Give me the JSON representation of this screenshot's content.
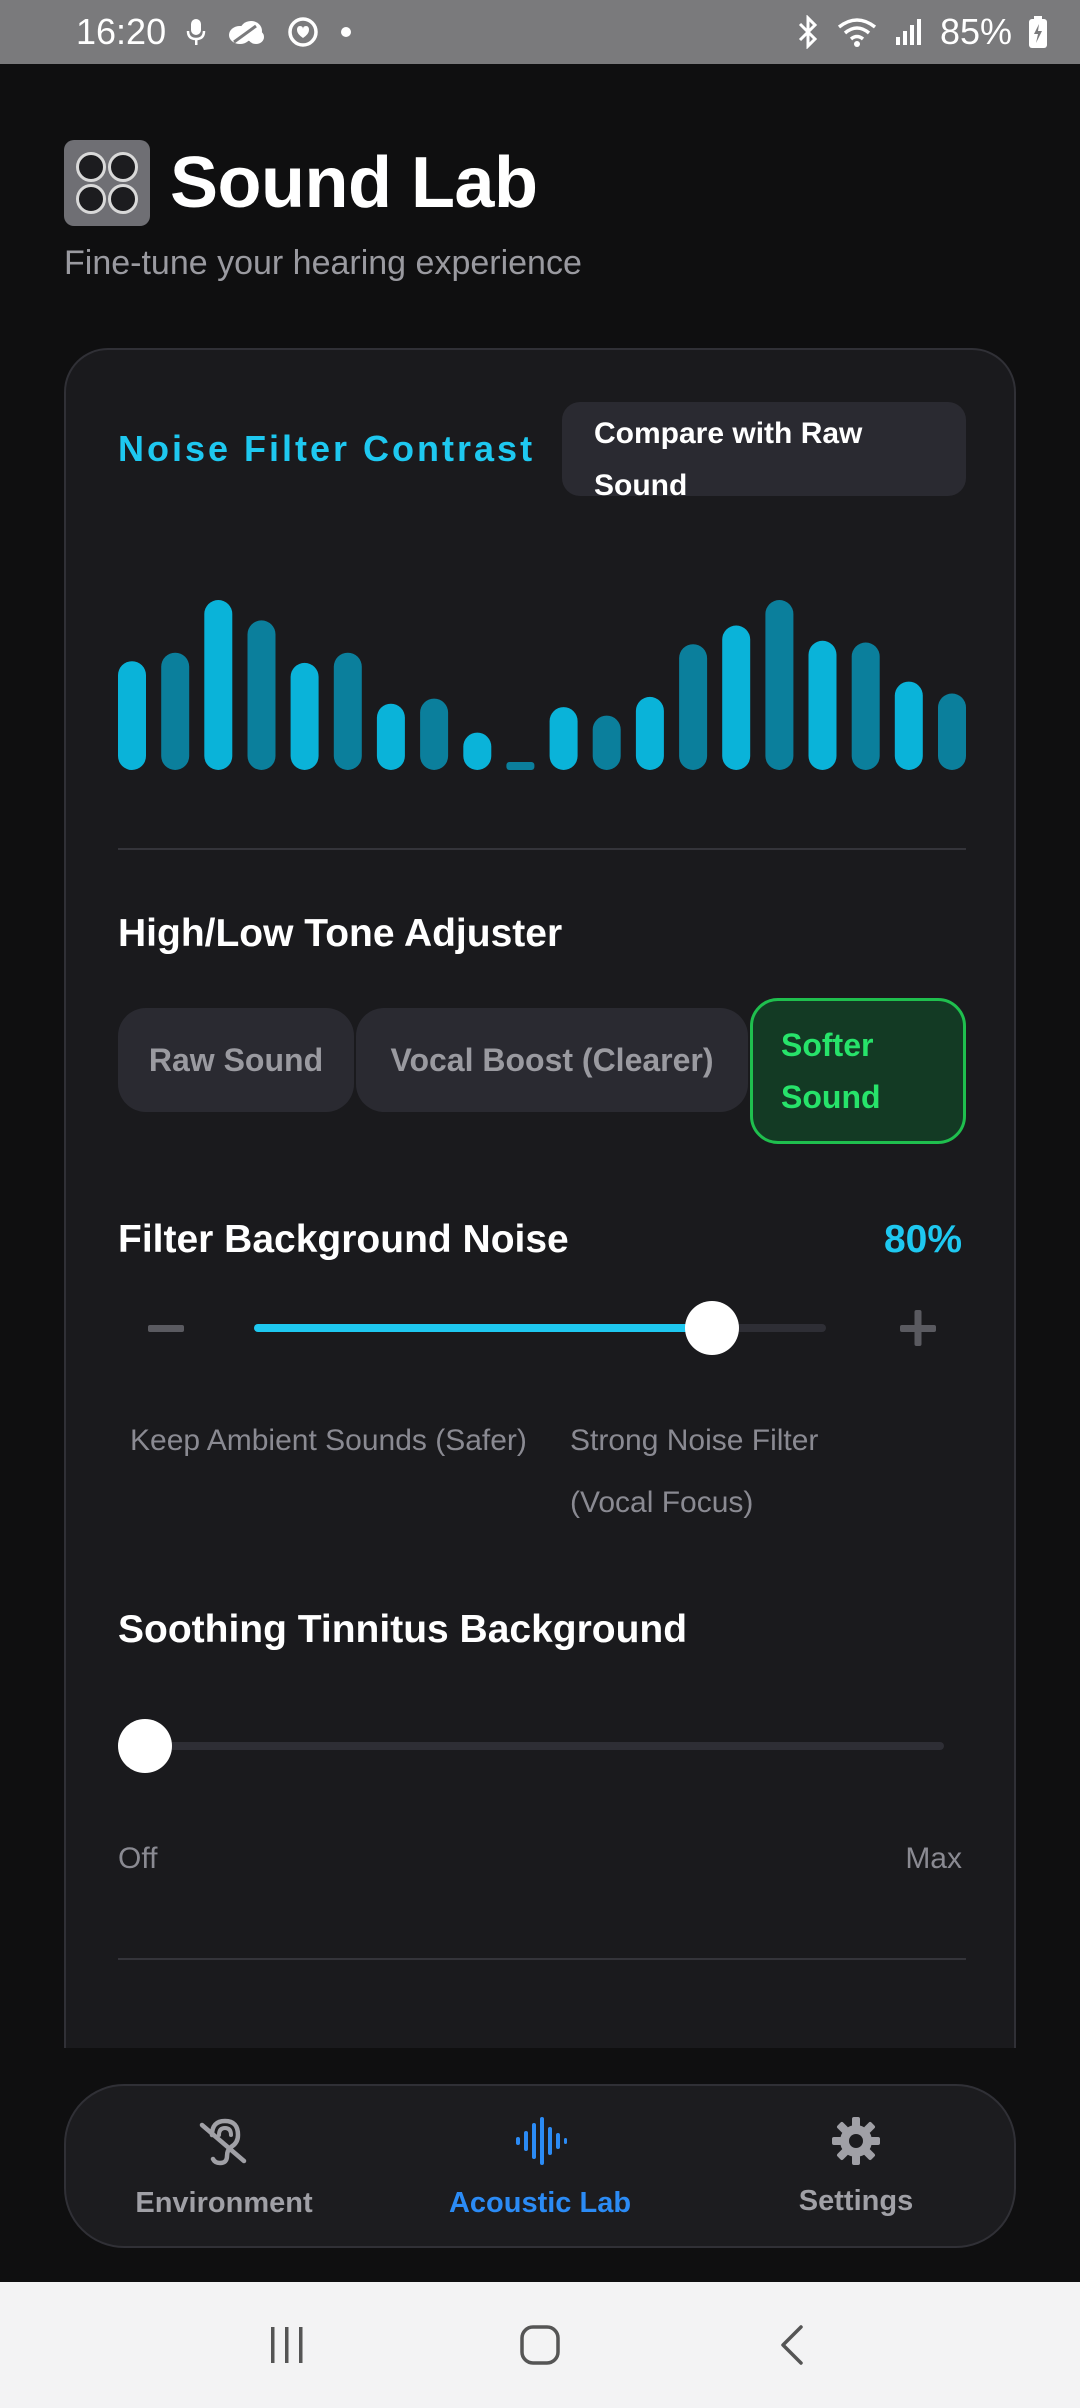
{
  "status_bar": {
    "time": "16:20",
    "battery": "85%"
  },
  "header": {
    "title": "Sound Lab",
    "subtitle": "Fine-tune your hearing experience"
  },
  "noise_filter": {
    "label": "Noise Filter Contrast",
    "compare_button": "Compare with Raw Sound"
  },
  "visualizer": {
    "bar_levels": [
      0.64,
      0.69,
      1.0,
      0.88,
      0.63,
      0.69,
      0.39,
      0.42,
      0.22,
      0.04,
      0.37,
      0.32,
      0.43,
      0.74,
      0.85,
      1.0,
      0.76,
      0.75,
      0.52,
      0.45
    ],
    "colors": {
      "bright": "#0ab3d9",
      "dim": "#0b7f9c"
    }
  },
  "tone": {
    "title": "High/Low Tone Adjuster",
    "options": [
      "Raw Sound",
      "Vocal Boost (Clearer)",
      "Softer Sound"
    ],
    "selected": "Softer Sound"
  },
  "noise_slider": {
    "title": "Filter Background Noise",
    "value_label": "80%",
    "value": 0.8,
    "min_hint": "Keep Ambient Sounds (Safer)",
    "max_hint": "Strong Noise Filter (Vocal Focus)"
  },
  "tinnitus": {
    "title": "Soothing Tinnitus Background",
    "value": 0,
    "min_label": "Off",
    "max_label": "Max"
  },
  "nav": {
    "items": [
      {
        "label": "Environment",
        "icon": "ear-icon"
      },
      {
        "label": "Acoustic Lab",
        "icon": "waveform-icon"
      },
      {
        "label": "Settings",
        "icon": "gear-icon"
      }
    ],
    "active": "Acoustic Lab",
    "accent": "#2b8bf5"
  },
  "theme": {
    "accent": "#1ec8f0",
    "success": "#27e36a",
    "background": "#0f0f10"
  }
}
